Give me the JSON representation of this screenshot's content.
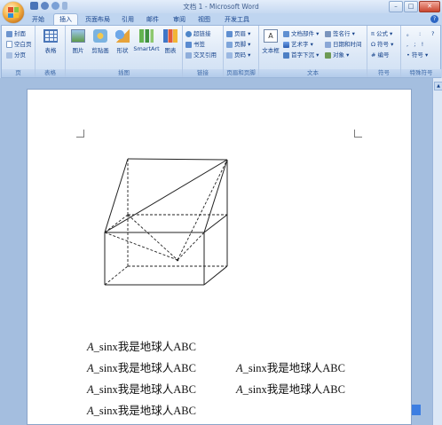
{
  "window": {
    "title": "文档 1 - Microsoft Word"
  },
  "tabs": [
    "开始",
    "插入",
    "页面布局",
    "引用",
    "邮件",
    "审阅",
    "视图",
    "开发工具"
  ],
  "ribbon": {
    "pages": {
      "label": "页",
      "items": [
        "封面",
        "空白页",
        "分页"
      ]
    },
    "table": {
      "label": "表格",
      "button": "表格"
    },
    "illustrations": {
      "label": "插图",
      "buttons": [
        "图片",
        "剪贴画",
        "形状",
        "SmartArt",
        "图表"
      ]
    },
    "links": {
      "label": "链接",
      "items": [
        "超链接",
        "书签",
        "交叉引用"
      ]
    },
    "header_footer": {
      "label": "页眉和页脚",
      "items": [
        "页眉",
        "页脚",
        "页码"
      ]
    },
    "text": {
      "label": "文本",
      "textbox": "文本框",
      "items": [
        "文档部件",
        "签名行",
        "艺术字",
        "日期和时间",
        "首字下沉",
        "对象"
      ]
    },
    "symbols": {
      "label": "符号",
      "items": [
        "公式",
        "符号",
        "编号"
      ]
    },
    "special": {
      "label": "特殊符号",
      "items": [
        "。",
        ":",
        "?",
        "符号"
      ]
    }
  },
  "document": {
    "lines": [
      [
        {
          "var": "A",
          "rest": "_sinx我是地球人ABC"
        }
      ],
      [
        {
          "var": "A",
          "rest": "_sinx我是地球人ABC"
        },
        {
          "var": "A",
          "rest": "_sinx我是地球人ABC"
        }
      ],
      [
        {
          "var": "A",
          "rest": "_sinx我是地球人ABC"
        },
        {
          "var": "A",
          "rest": "_sinx我是地球人ABC"
        }
      ],
      [
        {
          "var": "A",
          "rest": "_sinx我是地球人ABC"
        }
      ]
    ]
  },
  "colors": {
    "ribbon": "#dbe7f6",
    "workspace": "#a4bedf",
    "accent": "#15428b"
  }
}
